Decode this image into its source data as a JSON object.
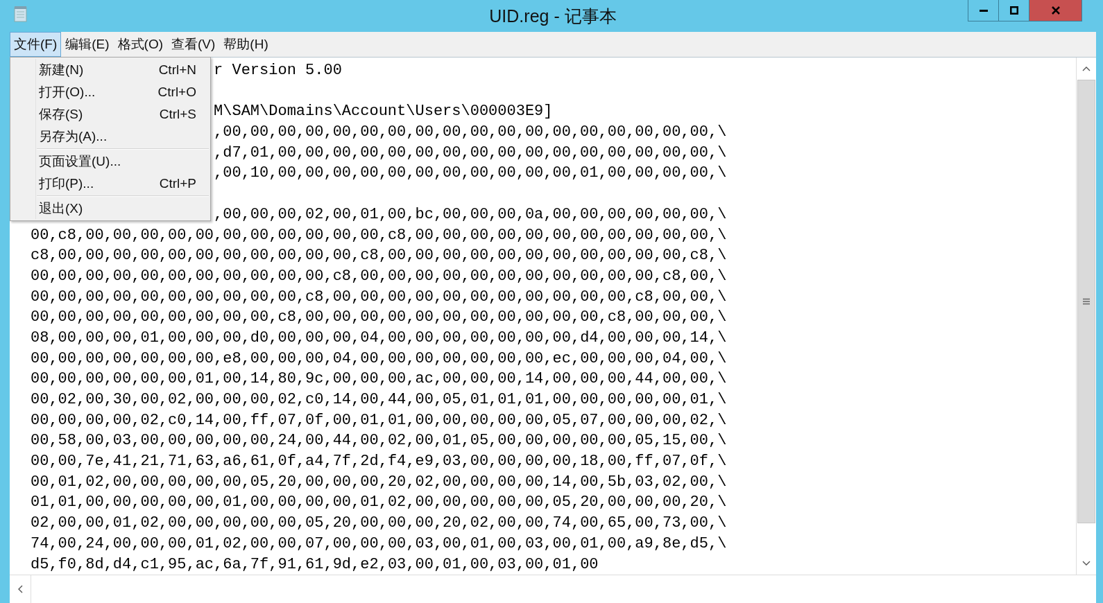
{
  "window": {
    "title": "UID.reg - 记事本",
    "controls": [
      {
        "kind": "minimize"
      },
      {
        "kind": "maximize"
      },
      {
        "kind": "close"
      }
    ]
  },
  "menu_bar": [
    {
      "label": "文件(F)",
      "selected": true
    },
    {
      "label": "编辑(E)",
      "selected": false
    },
    {
      "label": "格式(O)",
      "selected": false
    },
    {
      "label": "查看(V)",
      "selected": false
    },
    {
      "label": "帮助(H)",
      "selected": false
    }
  ],
  "dropdown": [
    {
      "kind": "item",
      "label": "新建(N)",
      "shortcut": "Ctrl+N"
    },
    {
      "kind": "item",
      "label": "打开(O)...",
      "shortcut": "Ctrl+O"
    },
    {
      "kind": "item",
      "label": "保存(S)",
      "shortcut": "Ctrl+S"
    },
    {
      "kind": "item",
      "label": "另存为(A)..."
    },
    {
      "kind": "separator"
    },
    {
      "kind": "item",
      "label": "页面设置(U)..."
    },
    {
      "kind": "item",
      "label": "打印(P)...",
      "shortcut": "Ctrl+P"
    },
    {
      "kind": "separator"
    },
    {
      "kind": "item",
      "label": "退出(X)"
    }
  ],
  "editor": {
    "lines": [
      {
        "kind": "tail",
        "caret": false,
        "text": "r Version 5.00"
      },
      {
        "kind": "tail",
        "caret": false
      },
      {
        "kind": "tail",
        "caret": false,
        "text": "M\\SAM\\Domains\\Account\\Users\\000003E9]"
      },
      {
        "kind": "tail",
        "caret": false,
        "text": ",00,00,00,00,00,00,00,00,00,00,00,00,00,00,00,00,00,00,\\"
      },
      {
        "kind": "tail",
        "caret": false,
        "text": ",d7,01,00,00,00,00,00,00,00,00,00,00,00,00,00,00,00,00,\\"
      },
      {
        "kind": "tail",
        "caret": false,
        "text": ",00,10,00,00,00,00,00,00,00,00,00,00,00,01,00,00,00,00,\\"
      },
      {
        "kind": "tail",
        "caret": true
      },
      {
        "kind": "tail",
        "caret": false,
        "text": ",00,00,00,02,00,01,00,bc,00,00,00,0a,00,00,00,00,00,00,\\"
      },
      {
        "kind": "full",
        "caret": false,
        "text": "00,c8,00,00,00,00,00,00,00,00,00,00,00,c8,00,00,00,00,00,00,00,00,00,00,00,\\"
      },
      {
        "kind": "full",
        "caret": false,
        "text": "c8,00,00,00,00,00,00,00,00,00,00,00,c8,00,00,00,00,00,00,00,00,00,00,00,c8,\\"
      },
      {
        "kind": "full",
        "caret": false,
        "text": "00,00,00,00,00,00,00,00,00,00,00,c8,00,00,00,00,00,00,00,00,00,00,00,c8,00,\\"
      },
      {
        "kind": "full",
        "caret": false,
        "text": "00,00,00,00,00,00,00,00,00,00,c8,00,00,00,00,00,00,00,00,00,00,00,c8,00,00,\\"
      },
      {
        "kind": "full",
        "caret": false,
        "text": "00,00,00,00,00,00,00,00,00,c8,00,00,00,00,00,00,00,00,00,00,00,c8,00,00,00,\\"
      },
      {
        "kind": "full",
        "caret": false,
        "text": "08,00,00,00,01,00,00,00,d0,00,00,00,04,00,00,00,00,00,00,00,d4,00,00,00,14,\\"
      },
      {
        "kind": "full",
        "caret": false,
        "text": "00,00,00,00,00,00,00,e8,00,00,00,04,00,00,00,00,00,00,00,ec,00,00,00,04,00,\\"
      },
      {
        "kind": "full",
        "caret": false,
        "text": "00,00,00,00,00,00,01,00,14,80,9c,00,00,00,ac,00,00,00,14,00,00,00,44,00,00,\\"
      },
      {
        "kind": "full",
        "caret": false,
        "text": "00,02,00,30,00,02,00,00,00,02,c0,14,00,44,00,05,01,01,01,00,00,00,00,00,01,\\"
      },
      {
        "kind": "full",
        "caret": false,
        "text": "00,00,00,00,02,c0,14,00,ff,07,0f,00,01,01,00,00,00,00,00,05,07,00,00,00,02,\\"
      },
      {
        "kind": "full",
        "caret": false,
        "text": "00,58,00,03,00,00,00,00,00,24,00,44,00,02,00,01,05,00,00,00,00,00,05,15,00,\\"
      },
      {
        "kind": "full",
        "caret": false,
        "text": "00,00,7e,41,21,71,63,a6,61,0f,a4,7f,2d,f4,e9,03,00,00,00,00,18,00,ff,07,0f,\\"
      },
      {
        "kind": "full",
        "caret": false,
        "text": "00,01,02,00,00,00,00,00,05,20,00,00,00,20,02,00,00,00,00,14,00,5b,03,02,00,\\"
      },
      {
        "kind": "full",
        "caret": false,
        "text": "01,01,00,00,00,00,00,01,00,00,00,00,01,02,00,00,00,00,00,05,20,00,00,00,20,\\"
      },
      {
        "kind": "full",
        "caret": false,
        "text": "02,00,00,01,02,00,00,00,00,00,05,20,00,00,00,20,02,00,00,74,00,65,00,73,00,\\"
      },
      {
        "kind": "full",
        "caret": false,
        "text": "74,00,24,00,00,00,01,02,00,00,07,00,00,00,03,00,01,00,03,00,01,00,a9,8e,d5,\\"
      },
      {
        "kind": "full",
        "caret": false,
        "text": "d5,f0,8d,d4,c1,95,ac,6a,7f,91,61,9d,e2,03,00,01,00,03,00,01,00"
      }
    ]
  }
}
